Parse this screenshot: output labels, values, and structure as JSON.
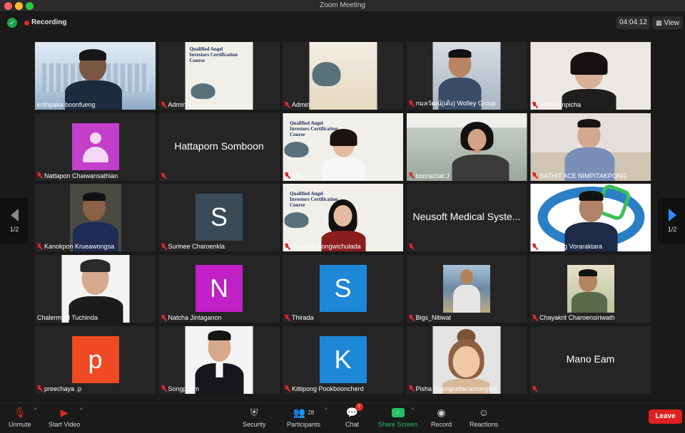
{
  "window": {
    "title": "Zoom Meeting"
  },
  "topbar": {
    "recording_label": "Recording",
    "timer": "04:04:12",
    "view_label": "View"
  },
  "pager": {
    "prev_page": "1/2",
    "next_page": "1/2"
  },
  "slides": {
    "line1": "Qualified Angel",
    "line2": "Investors Certification",
    "line3": "Course"
  },
  "participants": [
    {
      "name": "krithpaka boonfueng",
      "kind": "video",
      "muted": false,
      "active": true
    },
    {
      "name": "Admin 2",
      "kind": "slide",
      "muted": true
    },
    {
      "name": "Admin",
      "kind": "turtle",
      "muted": true
    },
    {
      "name": "กมลวัฒน์(เต้ง) Wolley Group",
      "kind": "video",
      "muted": true
    },
    {
      "name": "Sine Ponpicha",
      "kind": "video",
      "muted": true
    },
    {
      "name": "Nattapon Chaiwansathian",
      "kind": "avatar-person",
      "color": "#c33fc9",
      "muted": true
    },
    {
      "name": "Hattaporn Somboon",
      "kind": "name-only",
      "muted": true,
      "show_label": false
    },
    {
      "name": "MC",
      "kind": "slide-person",
      "muted": true
    },
    {
      "name": "boorachat J",
      "kind": "video",
      "muted": true
    },
    {
      "name": "SATHIT ACE NIMPITAKPONG",
      "kind": "video",
      "muted": true
    },
    {
      "name": "Kanokpon Krueawongsa",
      "kind": "video",
      "muted": true
    },
    {
      "name": "Surinee Charoenkla",
      "kind": "letter",
      "letter": "S",
      "color": "#3a4a56",
      "muted": true
    },
    {
      "name": "Jarunee Hongwichulada",
      "kind": "slide-person",
      "muted": true
    },
    {
      "name": "Neusoft Medical Syste...",
      "kind": "name-only",
      "muted": true,
      "show_label": false
    },
    {
      "name": "Burapong Voraraktara",
      "kind": "video-logo",
      "muted": true
    },
    {
      "name": "Chalermpol Tuchinda",
      "kind": "photo",
      "muted": false
    },
    {
      "name": "Natcha Jintaganon",
      "kind": "letter",
      "letter": "N",
      "color": "#c020c6",
      "muted": true
    },
    {
      "name": "Thirada",
      "kind": "letter",
      "letter": "S",
      "color": "#1d88d8",
      "muted": true
    },
    {
      "name": "Bigs_Nitiwat",
      "kind": "photo-sea",
      "muted": true
    },
    {
      "name": "Chayakrit Charoensiriwath",
      "kind": "photo",
      "muted": true
    },
    {
      "name": "preechaya .p",
      "kind": "letter",
      "letter": "p",
      "color": "#ef4a23",
      "muted": true
    },
    {
      "name": "Songpoom",
      "kind": "photo",
      "muted": true
    },
    {
      "name": "Kittipong Pookbooncherd",
      "kind": "letter",
      "letter": "K",
      "color": "#1d88d8",
      "muted": true
    },
    {
      "name": "Pisha Reungrattanamongkol",
      "kind": "cartoon",
      "muted": true
    },
    {
      "name": "Mano Eam",
      "kind": "name-only",
      "muted": true,
      "show_label": false
    }
  ],
  "toolbar": {
    "unmute": "Unmute",
    "start_video": "Start Video",
    "security": "Security",
    "participants": "Participants",
    "participants_count": "28",
    "chat": "Chat",
    "chat_badge": "7",
    "share_screen": "Share Screen",
    "record": "Record",
    "reactions": "Reactions",
    "leave": "Leave"
  }
}
